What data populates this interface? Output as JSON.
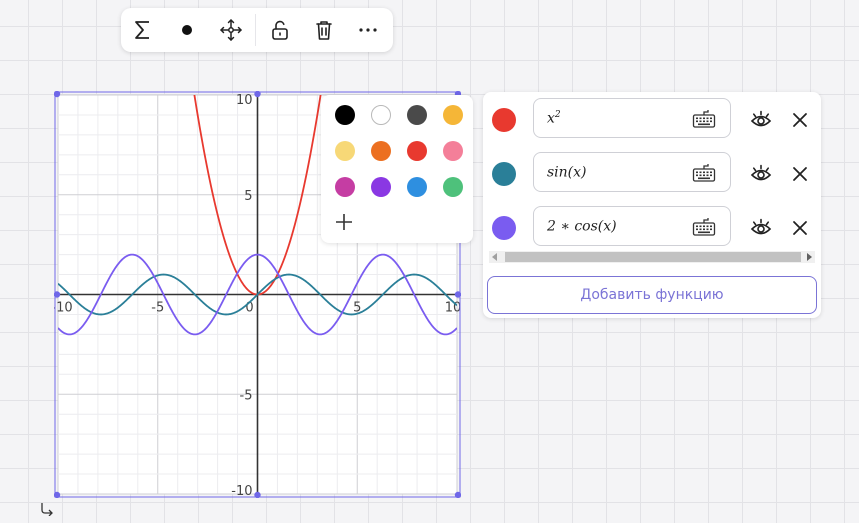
{
  "toolbar": {
    "buttons": [
      {
        "name": "sum-icon"
      },
      {
        "name": "point-icon"
      },
      {
        "name": "move-icon"
      },
      {
        "name": "unlock-icon"
      },
      {
        "name": "trash-icon"
      },
      {
        "name": "more-icon"
      }
    ]
  },
  "graph": {
    "x_ticks": [
      "-10",
      "-5",
      "0",
      "5",
      "10"
    ],
    "y_ticks": [
      "10",
      "5",
      "-5",
      "-10"
    ],
    "xlim": [
      -10,
      10
    ],
    "ylim": [
      -10,
      10
    ],
    "grid": true,
    "accent_color": "#6f67e8"
  },
  "chart_data": {
    "type": "line",
    "xlim": [
      -10,
      10
    ],
    "ylim": [
      -10,
      10
    ],
    "grid": true,
    "series": [
      {
        "expr": "x^2",
        "color": "#e8392f"
      },
      {
        "expr": "sin(x)",
        "color": "#2a7f98"
      },
      {
        "expr": "2 * cos(x)",
        "color": "#7a5cf0"
      }
    ]
  },
  "palette": {
    "colors": [
      "#000000",
      "#ffffff",
      "#4a4a4a",
      "#f5b637",
      "#f7d877",
      "#ec7021",
      "#e8392f",
      "#f47f99",
      "#c53da3",
      "#8a38e3",
      "#2e8fe0",
      "#4ec17b"
    ],
    "add_icon": "plus-icon"
  },
  "functions": [
    {
      "color": "#e8392f",
      "expr_base": "x",
      "expr_sup": "2",
      "expr_rest": ""
    },
    {
      "color": "#2a7f98",
      "expr_base": "sin(x)",
      "expr_sup": "",
      "expr_rest": ""
    },
    {
      "color": "#7a5cf0",
      "expr_base": "2 ∗ cos(x)",
      "expr_sup": "",
      "expr_rest": ""
    }
  ],
  "add_function_label": "Добавить функцию"
}
